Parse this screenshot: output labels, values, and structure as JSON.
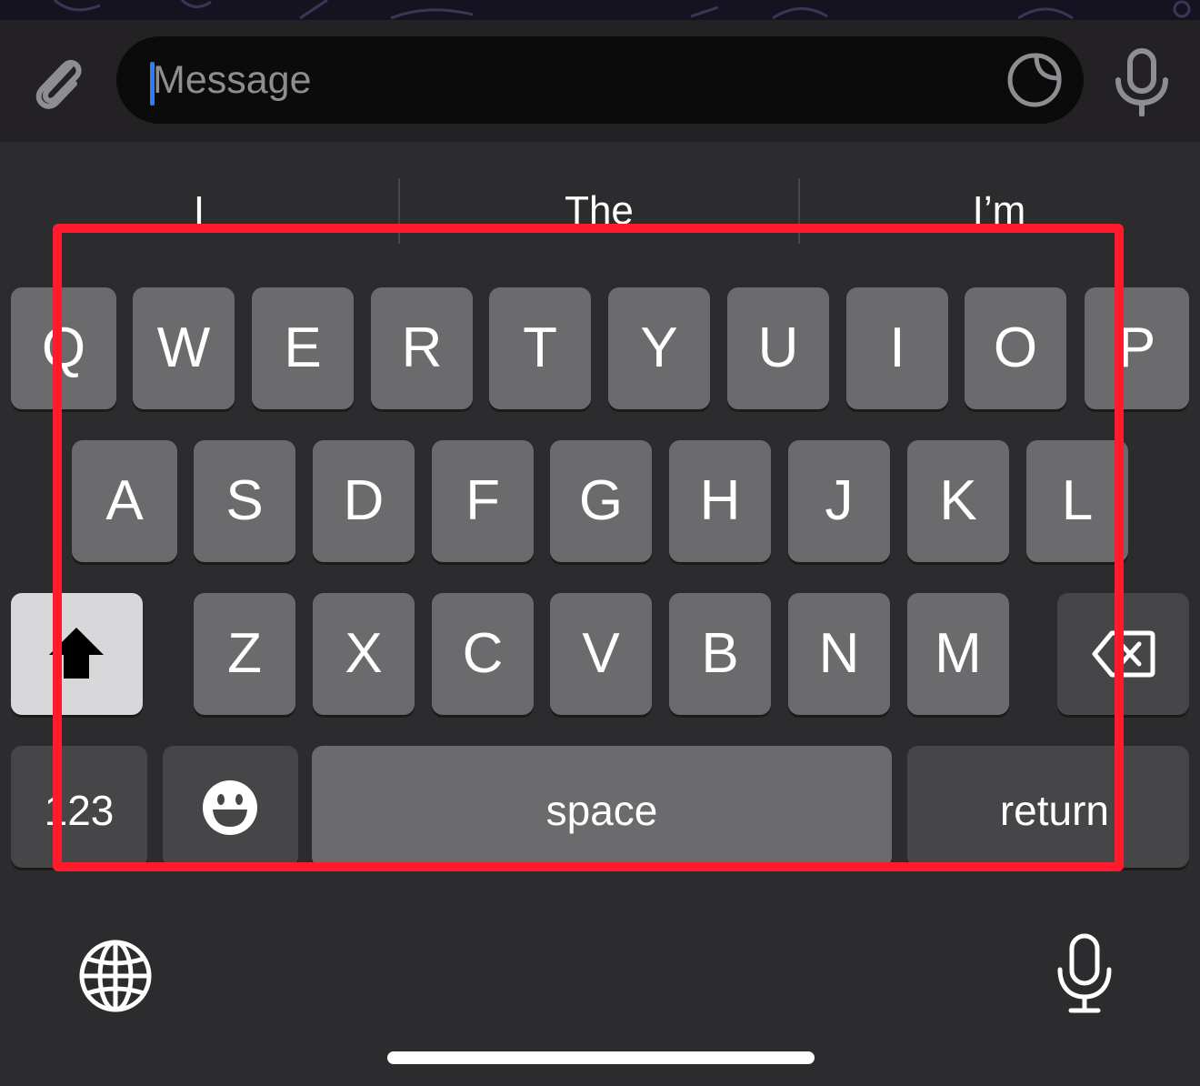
{
  "composer": {
    "placeholder": "Message",
    "attach_icon": "paperclip-icon",
    "sticker_icon": "sticker-icon",
    "voice_icon": "microphone-icon"
  },
  "suggestions": [
    "I",
    "The",
    "I’m"
  ],
  "keyboard": {
    "row1": [
      "Q",
      "W",
      "E",
      "R",
      "T",
      "Y",
      "U",
      "I",
      "O",
      "P"
    ],
    "row2": [
      "A",
      "S",
      "D",
      "F",
      "G",
      "H",
      "J",
      "K",
      "L"
    ],
    "row3": [
      "Z",
      "X",
      "C",
      "V",
      "B",
      "N",
      "M"
    ],
    "shift_icon": "shift-icon",
    "delete_icon": "delete-icon",
    "numbers_label": "123",
    "emoji_icon": "emoji-icon",
    "space_label": "space",
    "return_label": "return",
    "globe_icon": "globe-icon",
    "dictation_icon": "microphone-icon"
  },
  "colors": {
    "highlight": "#ff1a2c",
    "caret": "#2f7cf6",
    "key": "#6b6b6d",
    "key_dark": "#464648",
    "shift_active": "#d8d8da"
  }
}
